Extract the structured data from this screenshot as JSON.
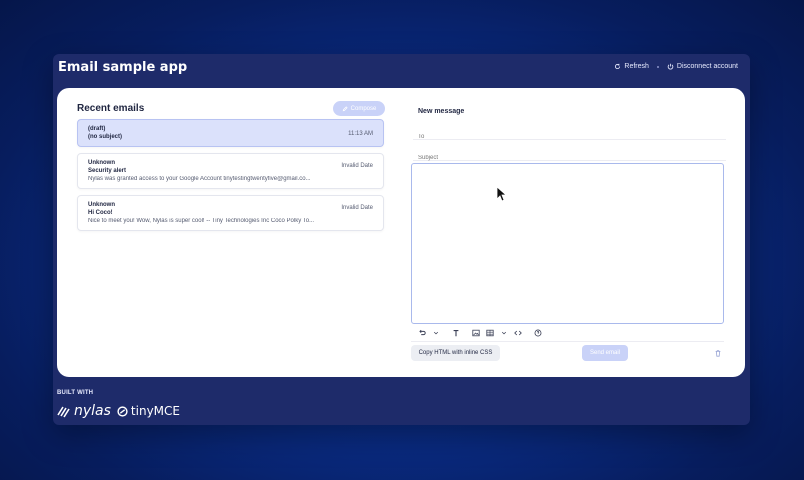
{
  "app": {
    "title": "Email sample app",
    "refresh_label": "Refresh",
    "disconnect_label": "Disconnect account"
  },
  "inbox": {
    "title": "Recent emails",
    "compose_label": "Compose",
    "emails": [
      {
        "from": "(draft)",
        "subject": "(no subject)",
        "snippet": "",
        "date": "11:13 AM",
        "selected": true
      },
      {
        "from": "Unknown",
        "subject": "Security alert",
        "snippet": "Nylas was granted access to your Google Account tinytestingtwentyfive@gmail.co...",
        "date": "Invalid Date",
        "selected": false
      },
      {
        "from": "Unknown",
        "subject": "Hi Coco!",
        "snippet": "Nice to meet you! Wow, Nylas is super cool! -- Tiny Technologies Inc Coco Polky To...",
        "date": "Invalid Date",
        "selected": false
      }
    ]
  },
  "composer": {
    "title": "New message",
    "to_placeholder": "To",
    "subject_placeholder": "Subject",
    "copy_label": "Copy HTML with inline CSS",
    "send_label": "Send email"
  },
  "footer": {
    "built_with": "BUILT WITH",
    "brand_a": "nylas",
    "brand_b": "tinyMCE"
  },
  "icons": {
    "refresh": "refresh-icon",
    "disconnect": "power-icon",
    "compose": "pencil-icon",
    "trash": "trash-icon"
  },
  "colors": {
    "background": "#0a2e8a",
    "app_frame": "#1e2b6a",
    "accent_soft": "#c9d2f8",
    "selected_row": "#dbe1fb"
  }
}
